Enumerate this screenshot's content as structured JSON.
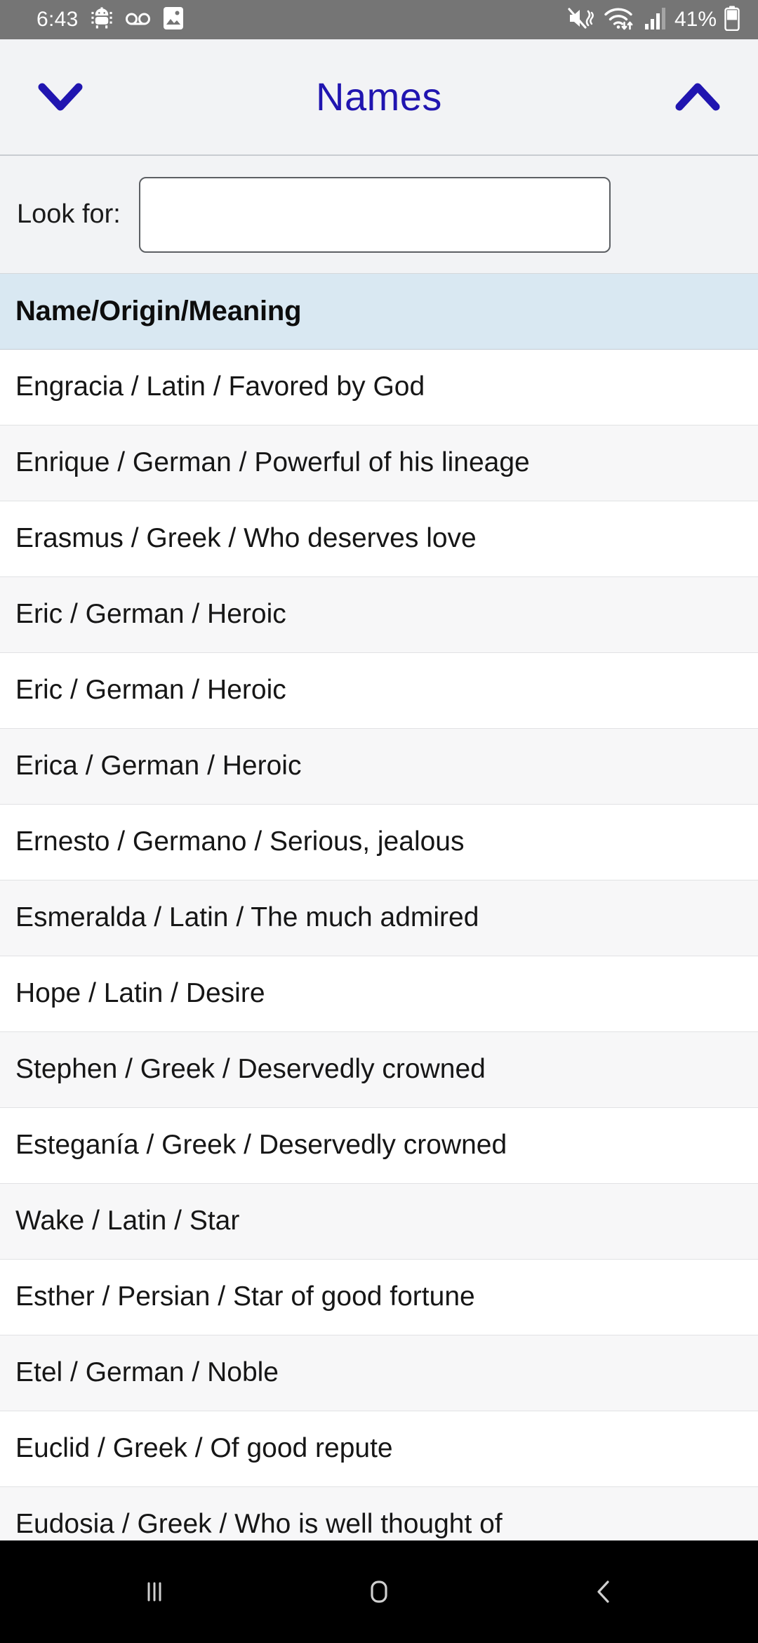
{
  "status_bar": {
    "time": "6:43",
    "battery_percent": "41%",
    "left_icons": [
      "android-debug-icon",
      "voicemail-icon",
      "screenshot-image-icon"
    ],
    "right_icons": [
      "mute-vibrate-icon",
      "wifi-icon",
      "cellular-signal-icon",
      "battery-icon"
    ],
    "background_color": "#757575",
    "foreground_color": "#ffffff"
  },
  "title_bar": {
    "title": "Names",
    "title_color": "#2015b0",
    "left_action": "scroll-down",
    "right_action": "scroll-up",
    "background_color": "#f2f3f5"
  },
  "search": {
    "label": "Look for:",
    "value": "",
    "placeholder": ""
  },
  "table": {
    "header": "Name/Origin/Meaning",
    "header_background": "#d9e8f2",
    "rows": [
      "Engracia / Latin / Favored by God",
      "Enrique / German / Powerful of his lineage",
      "Erasmus / Greek / Who deserves love",
      "Eric / German / Heroic",
      "Eric / German / Heroic",
      "Erica / German / Heroic",
      "Ernesto / Germano / Serious, jealous",
      "Esmeralda / Latin / The much admired",
      "Hope / Latin / Desire",
      "Stephen / Greek / Deservedly crowned",
      "Esteganía / Greek / Deservedly crowned",
      "Wake / Latin / Star",
      "Esther / Persian / Star of good fortune",
      "Etel / German / Noble",
      "Euclid / Greek / Of good repute",
      "Eudosia / Greek / Who is well thought of"
    ]
  },
  "nav_bar": {
    "recents_label": "recents-icon",
    "home_label": "home-icon",
    "back_label": "back-icon",
    "background_color": "#000000"
  }
}
